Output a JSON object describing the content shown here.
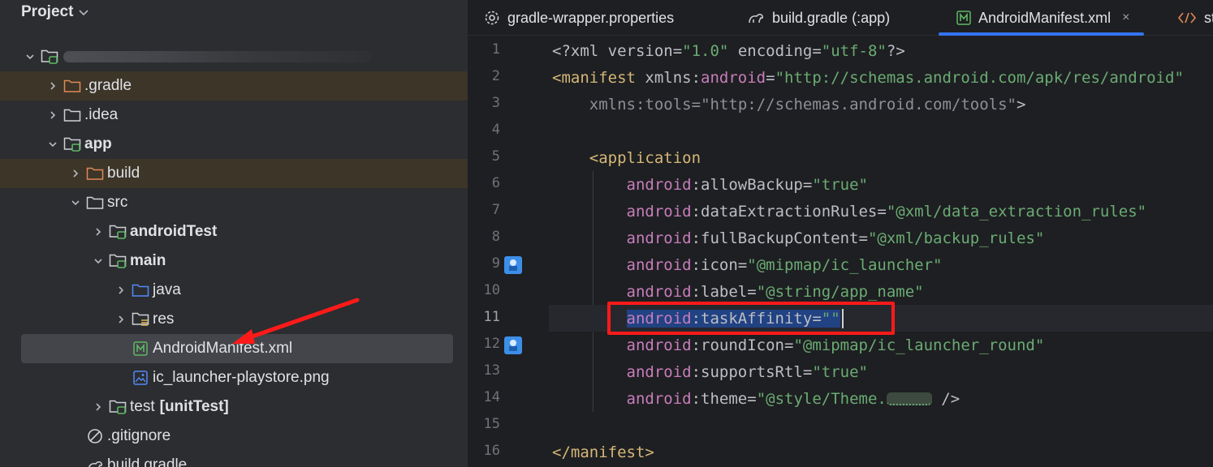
{
  "project_panel": {
    "title": "Project",
    "tree": [
      {
        "label": "",
        "bold": false,
        "indent": 0,
        "expanded": true,
        "icon": "module-folder-icon",
        "blurred": true
      },
      {
        "label": ".gradle",
        "bold": false,
        "indent": 1,
        "expanded": false,
        "icon": "excluded-folder-icon",
        "highlighted": true
      },
      {
        "label": ".idea",
        "bold": false,
        "indent": 1,
        "expanded": false,
        "icon": "folder-icon"
      },
      {
        "label": "app",
        "bold": true,
        "indent": 1,
        "expanded": true,
        "icon": "module-folder-icon"
      },
      {
        "label": "build",
        "bold": false,
        "indent": 2,
        "expanded": false,
        "icon": "excluded-folder-icon",
        "highlighted": true
      },
      {
        "label": "src",
        "bold": false,
        "indent": 2,
        "expanded": true,
        "icon": "folder-icon"
      },
      {
        "label": "androidTest",
        "bold": true,
        "indent": 3,
        "expanded": false,
        "icon": "module-folder-icon"
      },
      {
        "label": "main",
        "bold": true,
        "indent": 3,
        "expanded": true,
        "icon": "module-folder-icon"
      },
      {
        "label": "java",
        "bold": false,
        "indent": 4,
        "expanded": false,
        "icon": "source-folder-icon"
      },
      {
        "label": "res",
        "bold": false,
        "indent": 4,
        "expanded": false,
        "icon": "resource-folder-icon"
      },
      {
        "label": "AndroidManifest.xml",
        "bold": false,
        "indent": 4,
        "leaf": true,
        "icon": "manifest-file-icon",
        "selected": true
      },
      {
        "label": "ic_launcher-playstore.png",
        "bold": false,
        "indent": 4,
        "leaf": true,
        "icon": "image-file-icon"
      },
      {
        "label": "test",
        "suffix": "[unitTest]",
        "bold": false,
        "indent": 3,
        "expanded": false,
        "icon": "module-folder-icon"
      },
      {
        "label": ".gitignore",
        "bold": false,
        "indent": 2,
        "leaf": true,
        "icon": "ignore-file-icon"
      },
      {
        "label": "build.gradle",
        "bold": false,
        "indent": 2,
        "leaf": true,
        "icon": "gradle-file-icon"
      }
    ]
  },
  "editor": {
    "tabs": [
      {
        "label": "gradle-wrapper.properties",
        "icon": "properties-file-icon",
        "active": false
      },
      {
        "label": "build.gradle (:app)",
        "icon": "gradle-file-icon",
        "active": false
      },
      {
        "label": "AndroidManifest.xml",
        "icon": "manifest-file-icon",
        "active": true,
        "close": "×"
      },
      {
        "label": "st",
        "icon": "xml-file-icon",
        "active": false
      }
    ],
    "current_line": 11,
    "lines": [
      {
        "n": "1",
        "segs": [
          [
            "pi",
            "<?xml "
          ],
          [
            "attr",
            "version"
          ],
          [
            "pi",
            "="
          ],
          [
            "str",
            "\"1.0\""
          ],
          [
            "pi",
            " "
          ],
          [
            "attr",
            "encoding"
          ],
          [
            "pi",
            "="
          ],
          [
            "str",
            "\"utf-8\""
          ],
          [
            "pi",
            "?>"
          ]
        ]
      },
      {
        "n": "2",
        "segs": [
          [
            "tag",
            "<manifest "
          ],
          [
            "attr",
            "xmlns:"
          ],
          [
            "ns",
            "android"
          ],
          [
            "pi",
            "="
          ],
          [
            "str",
            "\"http://schemas.android.com/apk/res/android\""
          ]
        ]
      },
      {
        "n": "3",
        "segs": [
          [
            "pi",
            "    "
          ],
          [
            "dim",
            "xmlns:tools"
          ],
          [
            "dim",
            "="
          ],
          [
            "dim",
            "\"http://schemas.android.com/tools\""
          ],
          [
            "pi",
            ">"
          ]
        ]
      },
      {
        "n": "4",
        "segs": []
      },
      {
        "n": "5",
        "segs": [
          [
            "pi",
            "    "
          ],
          [
            "tag",
            "<application"
          ]
        ]
      },
      {
        "n": "6",
        "segs": [
          [
            "pi",
            "        "
          ],
          [
            "ns",
            "android"
          ],
          [
            "attr",
            ":allowBackup"
          ],
          [
            "pi",
            "="
          ],
          [
            "str",
            "\"true\""
          ]
        ]
      },
      {
        "n": "7",
        "segs": [
          [
            "pi",
            "        "
          ],
          [
            "ns",
            "android"
          ],
          [
            "attr",
            ":dataExtractionRules"
          ],
          [
            "pi",
            "="
          ],
          [
            "str",
            "\"@xml/data_extraction_rules\""
          ]
        ]
      },
      {
        "n": "8",
        "segs": [
          [
            "pi",
            "        "
          ],
          [
            "ns",
            "android"
          ],
          [
            "attr",
            ":fullBackupContent"
          ],
          [
            "pi",
            "="
          ],
          [
            "str",
            "\"@xml/backup_rules\""
          ]
        ]
      },
      {
        "n": "9",
        "segs": [
          [
            "pi",
            "        "
          ],
          [
            "ns",
            "android"
          ],
          [
            "attr",
            ":icon"
          ],
          [
            "pi",
            "="
          ],
          [
            "str",
            "\"@mipmap/ic_launcher\""
          ]
        ],
        "gutter_icon": "resource-preview-icon"
      },
      {
        "n": "10",
        "segs": [
          [
            "pi",
            "        "
          ],
          [
            "ns",
            "android"
          ],
          [
            "attr",
            ":label"
          ],
          [
            "pi",
            "="
          ],
          [
            "str",
            "\"@string/app_name\""
          ]
        ]
      },
      {
        "n": "11",
        "segs": [
          [
            "pi",
            "        "
          ],
          [
            "ns",
            "android"
          ],
          [
            "attr",
            ":taskAffinity"
          ],
          [
            "pi",
            "="
          ],
          [
            "str",
            "\"\""
          ]
        ],
        "selected": true
      },
      {
        "n": "12",
        "segs": [
          [
            "pi",
            "        "
          ],
          [
            "ns",
            "android"
          ],
          [
            "attr",
            ":roundIcon"
          ],
          [
            "pi",
            "="
          ],
          [
            "str",
            "\"@mipmap/ic_launcher_round\""
          ]
        ],
        "gutter_icon": "resource-preview-icon"
      },
      {
        "n": "13",
        "segs": [
          [
            "pi",
            "        "
          ],
          [
            "ns",
            "android"
          ],
          [
            "attr",
            ":supportsRtl"
          ],
          [
            "pi",
            "="
          ],
          [
            "str",
            "\"true\""
          ]
        ]
      },
      {
        "n": "14",
        "segs": [
          [
            "pi",
            "        "
          ],
          [
            "ns",
            "android"
          ],
          [
            "attr",
            ":theme"
          ],
          [
            "pi",
            "="
          ],
          [
            "str",
            "\"@style/Theme."
          ],
          [
            "blur",
            ""
          ],
          [
            "pi",
            " />"
          ]
        ]
      },
      {
        "n": "15",
        "segs": []
      },
      {
        "n": "16",
        "segs": [
          [
            "tag",
            "</manifest>"
          ]
        ]
      }
    ]
  },
  "colors": {
    "accent": "#3574f0",
    "annotation_red": "#ff1a1a",
    "xml_tag": "#d5b778",
    "xml_namespace": "#c77dbb",
    "xml_string": "#6aab73"
  }
}
